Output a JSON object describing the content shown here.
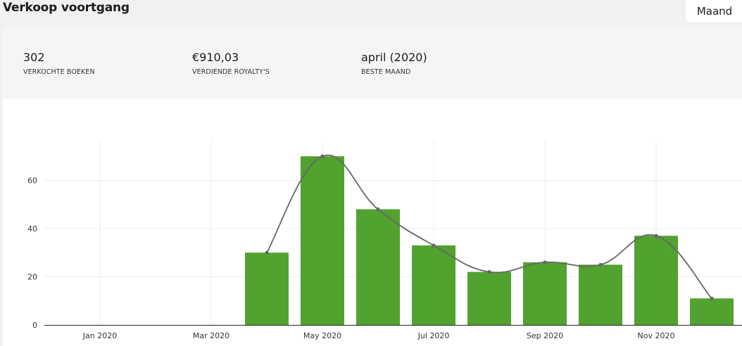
{
  "header": {
    "title": "Verkoop voortgang",
    "period_label": "Maand"
  },
  "stats": [
    {
      "value": "302",
      "label": "VERKOCHTE BOEKEN"
    },
    {
      "value": "€910,03",
      "label": "VERDIENDE ROYALTY'S"
    },
    {
      "value": "april (2020)",
      "label": "BESTE MAAND"
    }
  ],
  "colors": {
    "bar": "#52a22f",
    "line": "#666666",
    "grid": "#ececec",
    "axis": "#222222"
  },
  "chart_data": {
    "type": "bar",
    "categories": [
      "Jan 2020",
      "Feb 2020",
      "Mar 2020",
      "Apr 2020",
      "May 2020",
      "Jun 2020",
      "Jul 2020",
      "Aug 2020",
      "Sep 2020",
      "Oct 2020",
      "Nov 2020",
      "Dec 2020"
    ],
    "x_tick_labels": [
      "Jan 2020",
      "Mar 2020",
      "May 2020",
      "Jul 2020",
      "Sep 2020",
      "Nov 2020"
    ],
    "series": [
      {
        "values": [
          0,
          0,
          0,
          30,
          70,
          48,
          33,
          22,
          26,
          25,
          37,
          11
        ]
      }
    ],
    "overlay": "smoothed-line",
    "y_ticks": [
      0,
      20,
      40,
      60
    ],
    "ylim": [
      0,
      75
    ],
    "grid": true,
    "title": "",
    "xlabel": "",
    "ylabel": ""
  }
}
